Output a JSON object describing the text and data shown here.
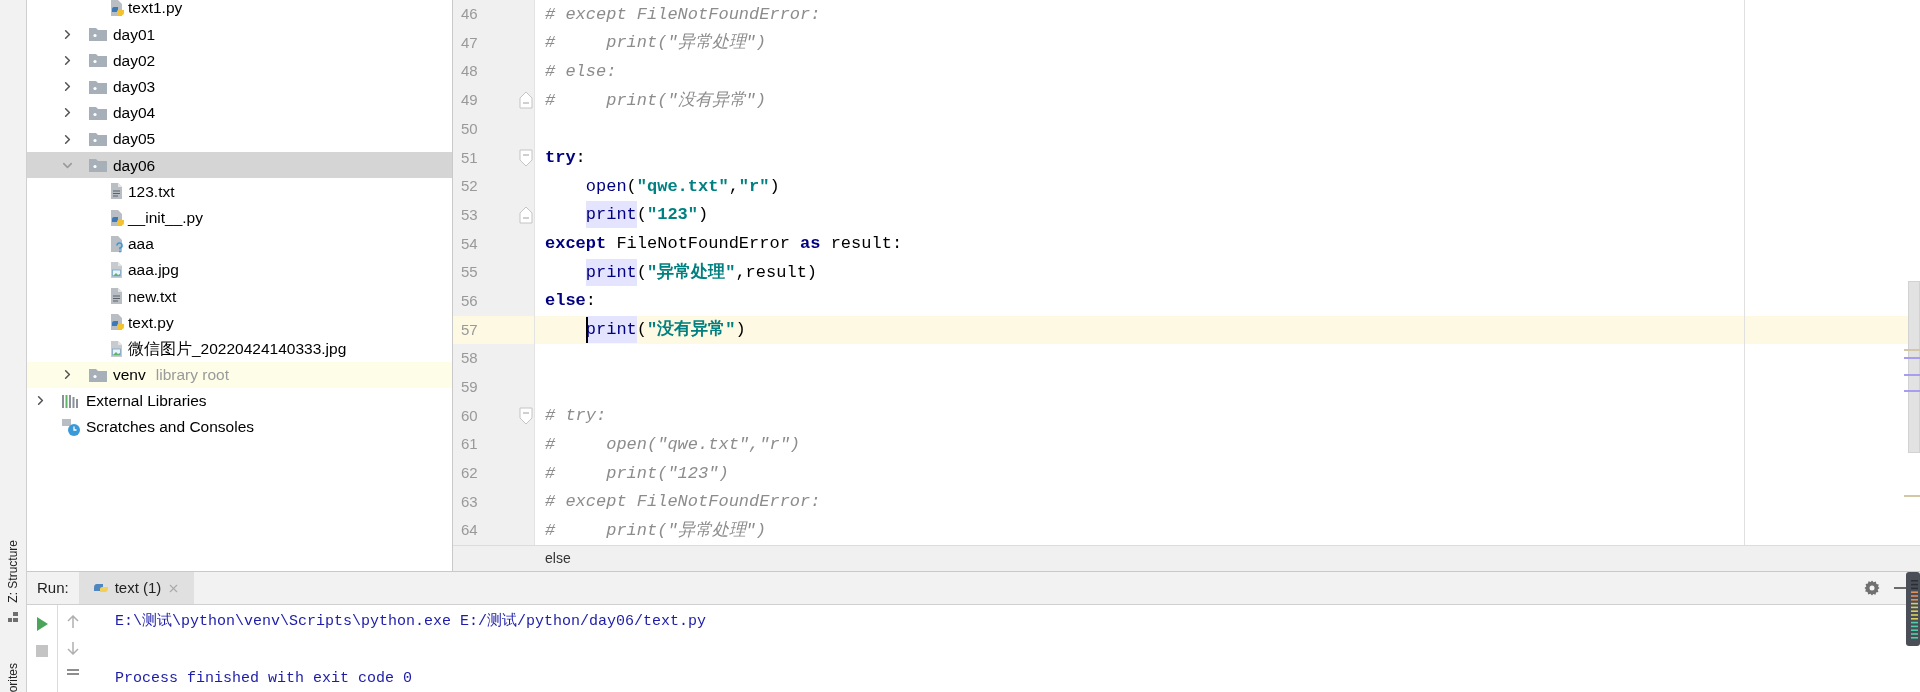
{
  "side_stripe": {
    "tabs": [
      {
        "label": "Z: Structure"
      },
      {
        "label": "orites"
      }
    ]
  },
  "project_tree": {
    "partial_children": [
      {
        "label": "text1.py",
        "kind": "python"
      }
    ],
    "folders": [
      {
        "label": "day01",
        "expanded": false,
        "selected": false,
        "highlighted": false
      },
      {
        "label": "day02",
        "expanded": false,
        "selected": false,
        "highlighted": false
      },
      {
        "label": "day03",
        "expanded": false,
        "selected": false,
        "highlighted": false
      },
      {
        "label": "day04",
        "expanded": false,
        "selected": false,
        "highlighted": false
      },
      {
        "label": "day05",
        "expanded": false,
        "selected": false,
        "highlighted": false
      },
      {
        "label": "day06",
        "expanded": true,
        "selected": true,
        "highlighted": false,
        "children": [
          {
            "label": "123.txt",
            "kind": "text"
          },
          {
            "label": "__init__.py",
            "kind": "python"
          },
          {
            "label": "aaa",
            "kind": "unknown"
          },
          {
            "label": "aaa.jpg",
            "kind": "image"
          },
          {
            "label": "new.txt",
            "kind": "text"
          },
          {
            "label": "text.py",
            "kind": "python"
          },
          {
            "label": "微信图片_20220424140333.jpg",
            "kind": "image"
          }
        ]
      },
      {
        "label": "venv",
        "note": "library root",
        "expanded": false,
        "selected": false,
        "highlighted": true
      }
    ],
    "roots": [
      {
        "label": "External Libraries",
        "kind": "libraries",
        "expandable": true
      },
      {
        "label": "Scratches and Consoles",
        "kind": "scratches",
        "expandable": false
      }
    ]
  },
  "editor": {
    "lines": [
      {
        "number": "46",
        "current": false,
        "indent": false,
        "fold_start": false,
        "fold_end": false,
        "tokens": [
          {
            "kind": "comment",
            "text": "# except FileNotFoundError:"
          }
        ]
      },
      {
        "number": "47",
        "current": false,
        "indent": false,
        "fold_start": false,
        "fold_end": false,
        "tokens": [
          {
            "kind": "comment",
            "text": "#     print(\"异常处理\")"
          }
        ]
      },
      {
        "number": "48",
        "current": false,
        "indent": false,
        "fold_start": false,
        "fold_end": false,
        "tokens": [
          {
            "kind": "comment",
            "text": "# else:"
          }
        ]
      },
      {
        "number": "49",
        "current": false,
        "indent": false,
        "fold_start": false,
        "fold_end": true,
        "tokens": [
          {
            "kind": "comment",
            "text": "#     print(\"没有异常\")"
          }
        ]
      },
      {
        "number": "50",
        "current": false,
        "fold_start": false,
        "fold_end": false
      },
      {
        "number": "51",
        "current": false,
        "indent": false,
        "fold_start": true,
        "fold_end": false,
        "tokens": [
          {
            "kind": "keyword",
            "text": "try"
          },
          {
            "kind": "plain",
            "text": ":"
          }
        ]
      },
      {
        "number": "52",
        "current": false,
        "indent": true,
        "fold_start": false,
        "fold_end": false,
        "tokens": [
          {
            "kind": "call",
            "text": "open",
            "highlighted": false
          },
          {
            "kind": "plain",
            "text": "("
          },
          {
            "kind": "string",
            "text": "\"qwe.txt\""
          },
          {
            "kind": "plain",
            "text": ","
          },
          {
            "kind": "string",
            "text": "\"r\""
          },
          {
            "kind": "plain",
            "text": ")"
          }
        ]
      },
      {
        "number": "53",
        "current": false,
        "indent": true,
        "fold_start": false,
        "fold_end": true,
        "tokens": [
          {
            "kind": "call",
            "text": "print",
            "highlighted": true
          },
          {
            "kind": "plain",
            "text": "("
          },
          {
            "kind": "string",
            "text": "\"123\""
          },
          {
            "kind": "plain",
            "text": ")"
          }
        ]
      },
      {
        "number": "54",
        "current": false,
        "indent": false,
        "fold_start": false,
        "fold_end": false,
        "tokens": [
          {
            "kind": "keyword",
            "text": "except"
          },
          {
            "kind": "plain",
            "text": " FileNotFoundError "
          },
          {
            "kind": "keyword",
            "text": "as"
          },
          {
            "kind": "plain",
            "text": " result:"
          }
        ]
      },
      {
        "number": "55",
        "current": false,
        "indent": true,
        "fold_start": false,
        "fold_end": false,
        "tokens": [
          {
            "kind": "call",
            "text": "print",
            "highlighted": true
          },
          {
            "kind": "plain",
            "text": "("
          },
          {
            "kind": "string",
            "text": "\"异常处理\""
          },
          {
            "kind": "plain",
            "text": ",result)"
          }
        ]
      },
      {
        "number": "56",
        "current": false,
        "indent": false,
        "fold_start": false,
        "fold_end": false,
        "tokens": [
          {
            "kind": "keyword",
            "text": "else"
          },
          {
            "kind": "plain",
            "text": ":"
          }
        ]
      },
      {
        "number": "57",
        "current": true,
        "indent": true,
        "fold_start": false,
        "fold_end": false,
        "tokens": [
          {
            "kind": "call",
            "text": "print",
            "highlighted": true
          },
          {
            "kind": "plain",
            "text": "("
          },
          {
            "kind": "string",
            "text": "\"没有异常\""
          },
          {
            "kind": "plain",
            "text": ")"
          }
        ]
      },
      {
        "number": "58",
        "current": false,
        "fold_start": false,
        "fold_end": false
      },
      {
        "number": "59",
        "current": false,
        "fold_start": false,
        "fold_end": false
      },
      {
        "number": "60",
        "current": false,
        "indent": false,
        "fold_start": true,
        "fold_end": false,
        "tokens": [
          {
            "kind": "comment",
            "text": "# try:"
          }
        ]
      },
      {
        "number": "61",
        "current": false,
        "indent": false,
        "fold_start": false,
        "fold_end": false,
        "tokens": [
          {
            "kind": "comment",
            "text": "#     open(\"qwe.txt\",\"r\")"
          }
        ]
      },
      {
        "number": "62",
        "current": false,
        "indent": false,
        "fold_start": false,
        "fold_end": false,
        "tokens": [
          {
            "kind": "comment",
            "text": "#     print(\"123\")"
          }
        ]
      },
      {
        "number": "63",
        "current": false,
        "indent": false,
        "fold_start": false,
        "fold_end": false,
        "tokens": [
          {
            "kind": "comment",
            "text": "# except FileNotFoundError:"
          }
        ]
      },
      {
        "number": "64",
        "current": false,
        "indent": false,
        "fold_start": false,
        "fold_end": false,
        "tokens": [
          {
            "kind": "comment",
            "text": "#     print(\"异常处理\")"
          }
        ]
      }
    ],
    "breadcrumb": "else"
  },
  "run_panel": {
    "label": "Run:",
    "tabs": [
      {
        "label": "text (1)",
        "selected": true
      }
    ],
    "output": [
      {
        "kind": "text",
        "text": "E:\\测试\\python\\venv\\Scripts\\python.exe E:/测试/python/day06/text.py"
      },
      {
        "kind": "blank"
      },
      {
        "kind": "text",
        "text": "Process finished with exit code 0"
      }
    ]
  }
}
